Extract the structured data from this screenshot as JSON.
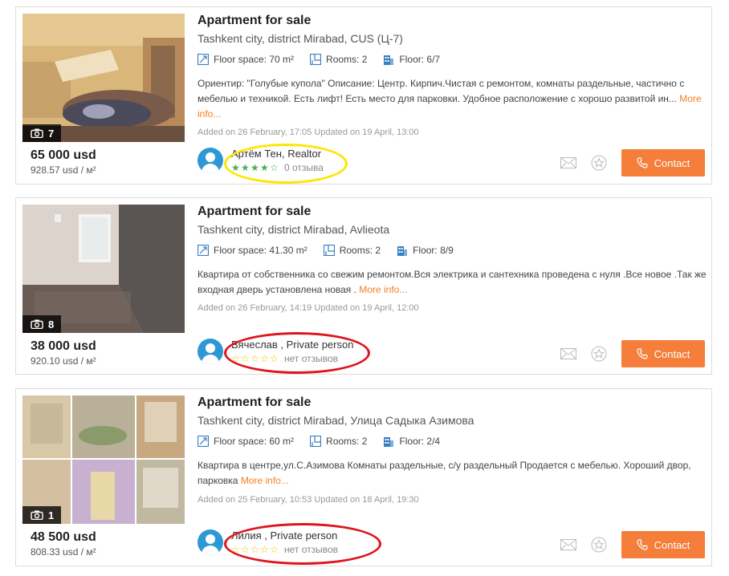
{
  "listings": [
    {
      "title": "Apartment for sale",
      "address": "Tashkent city, district Mirabad, CUS (Ц-7)",
      "floor_space_label": "Floor space: 70 m²",
      "rooms_label": "Rooms: 2",
      "floor_label": "Floor: 6/7",
      "description": "Ориентир: \"Голубые купола\" Описание: Центр. Кирпич.Чистая с ремонтом, комнаты раздельные, частично с мебелью и техникой. Есть лифт! Есть место для парковки. Удобное расположение с хорошо развитой ин...",
      "more_info": "More info...",
      "dates": "Added on 26 February, 17:05 Updated on 19 April, 13:00",
      "photo_count": "7",
      "price": "65 000 usd",
      "price_per_m2": "928.57 usd / м²",
      "seller_name": "Артём Тен, Realtor",
      "rating_text": "0 отзыва",
      "stars": 4,
      "contact_label": "Contact"
    },
    {
      "title": "Apartment for sale",
      "address": "Tashkent city, district Mirabad, Avlieota",
      "floor_space_label": "Floor space: 41.30 m²",
      "rooms_label": "Rooms: 2",
      "floor_label": "Floor: 8/9",
      "description": "Квартира от собственника со свежим ремонтом.Вся электрика и сантехника проведена с нуля .Все новое .Так же входная дверь установлена новая .",
      "more_info": "More info...",
      "dates": "Added on 26 February, 14:19 Updated on 19 April, 12:00",
      "photo_count": "8",
      "price": "38 000 usd",
      "price_per_m2": "920.10 usd / м²",
      "seller_name": "Вячеслав , Private person",
      "rating_text": "нет отзывов",
      "stars": 0,
      "contact_label": "Contact"
    },
    {
      "title": "Apartment for sale",
      "address": "Tashkent city, district Mirabad, Улица Садыка Азимова",
      "floor_space_label": "Floor space: 60 m²",
      "rooms_label": "Rooms: 2",
      "floor_label": "Floor: 2/4",
      "description": "Квартира в центре,ул.С.Азимова Комнаты раздельные, с/у раздельный Продается с мебелью. Хороший двор, парковка",
      "more_info": "More info...",
      "dates": "Added on 25 February, 10:53 Updated on 18 April, 19:30",
      "photo_count": "1",
      "price": "48 500 usd",
      "price_per_m2": "808.33 usd / м²",
      "seller_name": "Лилия , Private person",
      "rating_text": "нет отзывов",
      "stars": 0,
      "contact_label": "Contact"
    }
  ],
  "colors": {
    "accent": "#f47e3a",
    "more_link": "#f47e20",
    "avatar": "#2d98d4",
    "highlight_yellow": "#ffe600",
    "highlight_red": "#e0141e"
  }
}
